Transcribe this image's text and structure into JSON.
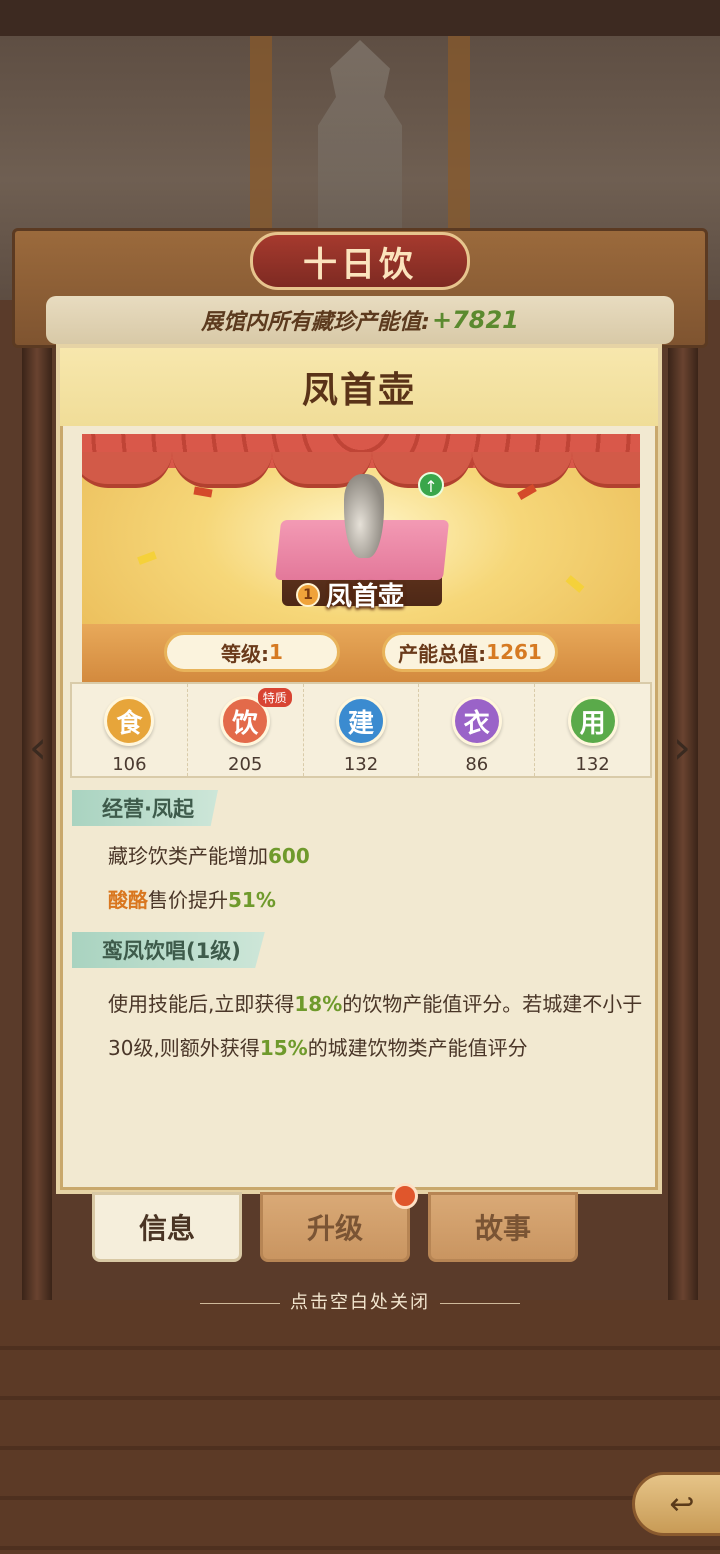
{
  "hall": {
    "title": "十日饮",
    "total_label": "展馆内所有藏珍产能值:",
    "total_value": "+7821"
  },
  "item": {
    "name_heading": "凤首壶",
    "name_label": "凤首壶",
    "badge": "1",
    "level_label": "等级:",
    "level_value": "1",
    "output_label": "产能总值:",
    "output_value": "1261"
  },
  "attributes": [
    {
      "icon": "食",
      "value": "106",
      "color": "#e7a53a"
    },
    {
      "icon": "饮",
      "value": "205",
      "color": "#e36a4a",
      "tag": "特质"
    },
    {
      "icon": "建",
      "value": "132",
      "color": "#3b8bd0"
    },
    {
      "icon": "衣",
      "value": "86",
      "color": "#9a63c8"
    },
    {
      "icon": "用",
      "value": "132",
      "color": "#5aaa4a"
    }
  ],
  "skill1": {
    "title": "经营·凤起",
    "line1_text": "藏珍饮类产能增加",
    "line1_value": "600",
    "line2_orange": "酸酪",
    "line2_text": "售价提升",
    "line2_value": "51%"
  },
  "skill2": {
    "title": "鸾凤饮唱(1级)",
    "desc_a": "使用技能后,立即获得",
    "desc_b": "18%",
    "desc_c": "的饮物产能值评分。若城建不小于30级,则额外获得",
    "desc_d": "15%",
    "desc_e": "的城建饮物类产能值评分"
  },
  "tabs": {
    "info": "信息",
    "upgrade": "升级",
    "story": "故事"
  },
  "close_hint": "点击空白处关闭",
  "icons": {
    "prev": "chevron-left-icon",
    "next": "chevron-right-icon",
    "back": "back-arrow-icon",
    "upgrade": "arrow-up-icon"
  }
}
